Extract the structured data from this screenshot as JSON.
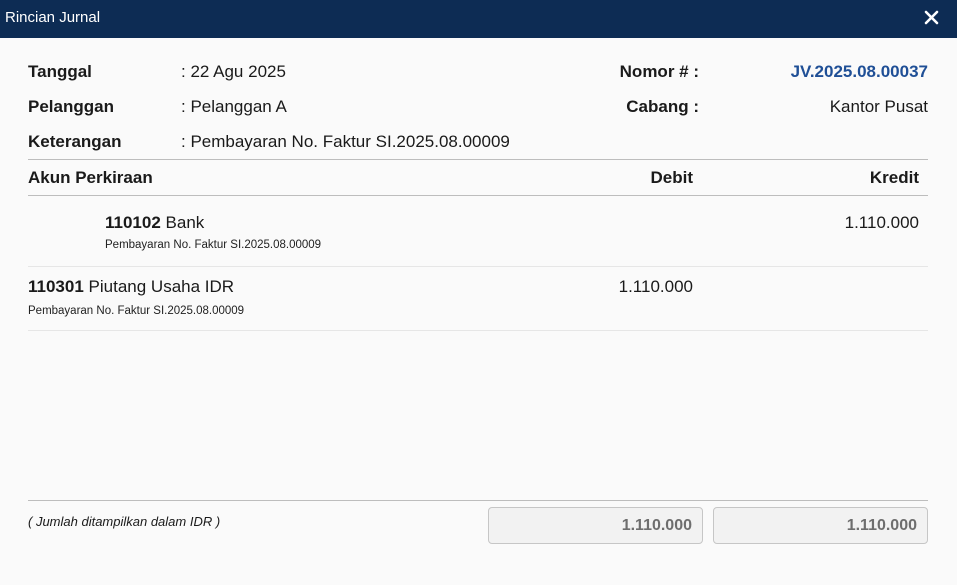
{
  "window": {
    "title": "Rincian Jurnal"
  },
  "header": {
    "tanggal_label": "Tanggal",
    "tanggal_value": ": 22 Agu 2025",
    "pelanggan_label": "Pelanggan",
    "pelanggan_value": ": Pelanggan A",
    "keterangan_label": "Keterangan",
    "keterangan_value": ": Pembayaran No. Faktur SI.2025.08.00009",
    "nomor_label": "Nomor # :",
    "nomor_value": "JV.2025.08.00037",
    "cabang_label": "Cabang :",
    "cabang_value": "Kantor Pusat"
  },
  "table": {
    "columns": [
      "Akun Perkiraan",
      "Debit",
      "Kredit"
    ],
    "rows": [
      {
        "code": "110102",
        "name": "Bank",
        "memo": "Pembayaran No. Faktur SI.2025.08.00009",
        "debit": "",
        "kredit": "1.110.000"
      },
      {
        "code": "110301",
        "name": "Piutang Usaha IDR",
        "memo": "Pembayaran No. Faktur SI.2025.08.00009",
        "debit": "1.110.000",
        "kredit": ""
      }
    ]
  },
  "footer": {
    "note": "( Jumlah ditampilkan dalam IDR )",
    "total_debit": "1.110.000",
    "total_kredit": "1.110.000"
  },
  "colors": {
    "titlebar": "#0d2c54",
    "link": "#1f4f96"
  },
  "icons": {
    "close": "close-icon"
  }
}
